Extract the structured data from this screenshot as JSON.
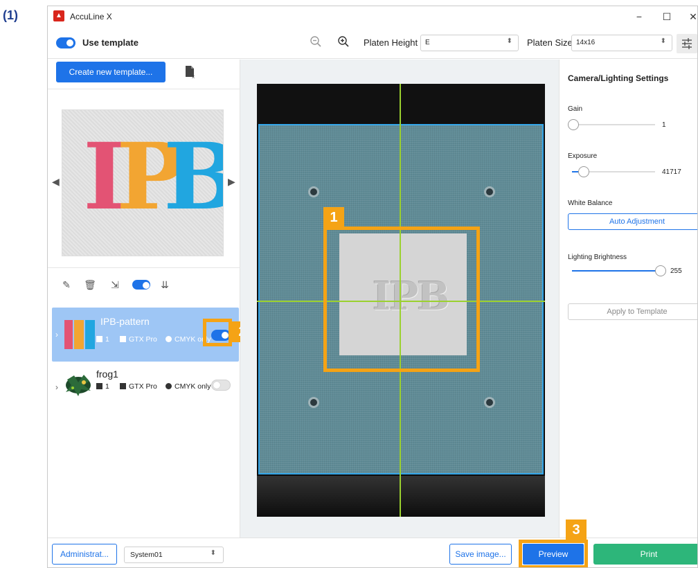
{
  "figure_label": "(1)",
  "window": {
    "title": "AccuLine X",
    "controls": {
      "minimize": "−",
      "maximize": "☐",
      "close": "✕"
    }
  },
  "toolbar": {
    "use_template_label": "Use template",
    "use_template_on": true,
    "platen_height_label": "Platen Height",
    "platen_height_value": "E",
    "platen_size_label": "Platen Size",
    "platen_size_value": "14x16"
  },
  "left_panel": {
    "create_button": "Create new template...",
    "preview_image_text": [
      "I",
      "P",
      "B"
    ],
    "templates": [
      {
        "name": "IPB-pattern",
        "count": "1",
        "printer": "GTX Pro",
        "ink": "CMYK only",
        "enabled": true,
        "selected": true
      },
      {
        "name": "frog1",
        "count": "1",
        "printer": "GTX Pro",
        "ink": "CMYK only",
        "enabled": false,
        "selected": false
      }
    ]
  },
  "camera": {
    "patch_text": "IPB"
  },
  "settings": {
    "title": "Camera/Lighting Settings",
    "gain_label": "Gain",
    "gain_value": "1",
    "exposure_label": "Exposure",
    "exposure_value": "41717",
    "white_balance_label": "White Balance",
    "auto_adjustment_button": "Auto Adjustment",
    "lighting_label": "Lighting Brightness",
    "lighting_value": "255",
    "apply_button": "Apply to Template"
  },
  "bottom_bar": {
    "admin_button": "Administrat...",
    "system_value": "System01",
    "save_image_button": "Save image...",
    "preview_button": "Preview",
    "print_button": "Print"
  },
  "callouts": [
    "1",
    "2",
    "3"
  ],
  "colors": {
    "accent": "#1e73e8",
    "print_green": "#2db67a",
    "callout_orange": "#f5a315",
    "crosshair": "#9bd12f",
    "selected_row": "#9ec6f5"
  }
}
